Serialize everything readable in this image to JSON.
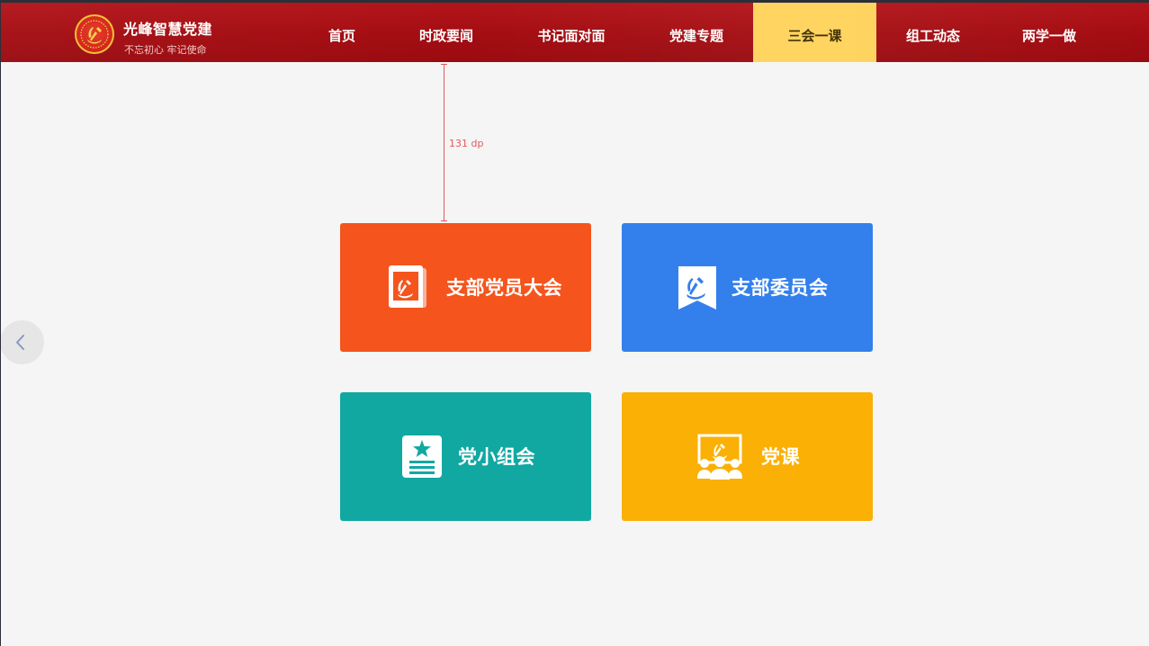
{
  "brand": {
    "title": "光峰智慧党建",
    "subtitle": "不忘初心 牢记使命"
  },
  "nav": [
    {
      "label": "首页",
      "active": false
    },
    {
      "label": "时政要闻",
      "active": false
    },
    {
      "label": "书记面对面",
      "active": false
    },
    {
      "label": "党建专题",
      "active": false
    },
    {
      "label": "三会一课",
      "active": true
    },
    {
      "label": "组工动态",
      "active": false
    },
    {
      "label": "两学一做",
      "active": false
    }
  ],
  "annotation": {
    "spacing_label": "131 dp"
  },
  "cards": [
    {
      "label": "支部党员大会",
      "icon": "party-book-icon",
      "color": "#f5541d"
    },
    {
      "label": "支部委员会",
      "icon": "party-bookmark-icon",
      "color": "#3380ec"
    },
    {
      "label": "党小组会",
      "icon": "star-document-icon",
      "color": "#11a8a2"
    },
    {
      "label": "党课",
      "icon": "lecture-audience-icon",
      "color": "#fab005"
    }
  ],
  "colors": {
    "header": "#a30d12",
    "active_tab": "#ffd25a",
    "background": "#f5f5f5",
    "annotation": "#e05a5a"
  }
}
